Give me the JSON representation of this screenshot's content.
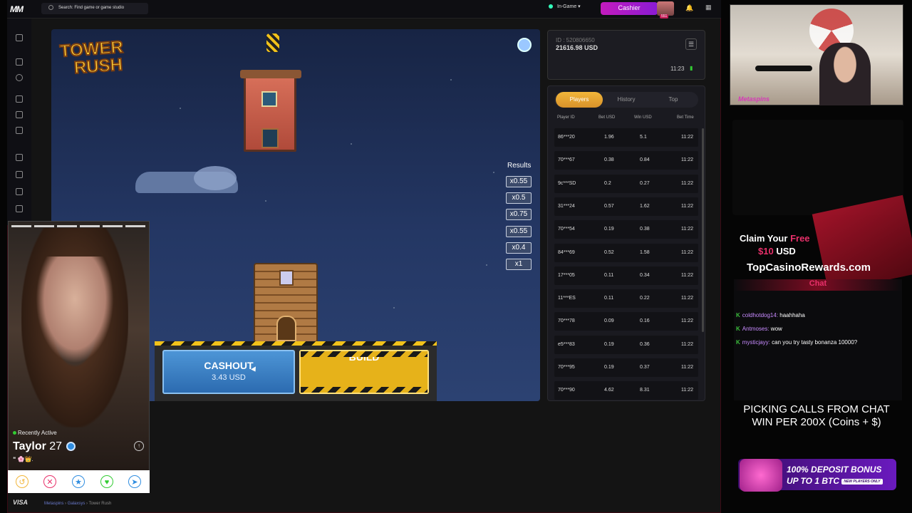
{
  "topbar": {
    "logo": "MM",
    "search_placeholder": "Search: Find game or game studio",
    "status": "In-Game",
    "cashier_label": "Cashier",
    "level_badge": "551"
  },
  "game": {
    "title_line1": "TOWER",
    "title_line2": "RUSH",
    "results_title": "Results",
    "results": [
      "x0.55",
      "x0.5",
      "x0.75",
      "x0.55",
      "x0.4",
      "x1"
    ],
    "cashout_label": "CASHOUT",
    "cashout_amount": "3.43 USD",
    "build_label": "BUILD"
  },
  "account": {
    "id": "ID : 520806650",
    "balance": "21616.98 USD",
    "time": "11:23"
  },
  "players_panel": {
    "tabs": [
      "Players",
      "History",
      "Top"
    ],
    "active_tab": "Players",
    "headers": [
      "Player ID",
      "Bet USD",
      "Win USD",
      "Bet Time"
    ],
    "rows": [
      [
        "86***20",
        "1.96",
        "5.1",
        "11:22"
      ],
      [
        "70***67",
        "0.38",
        "0.84",
        "11:22"
      ],
      [
        "9c***SD",
        "0.2",
        "0.27",
        "11:22"
      ],
      [
        "31***24",
        "0.57",
        "1.62",
        "11:22"
      ],
      [
        "70***54",
        "0.19",
        "0.38",
        "11:22"
      ],
      [
        "84***69",
        "0.52",
        "1.58",
        "11:22"
      ],
      [
        "17***05",
        "0.11",
        "0.34",
        "11:22"
      ],
      [
        "11***ES",
        "0.11",
        "0.22",
        "11:22"
      ],
      [
        "70***78",
        "0.09",
        "0.16",
        "11:22"
      ],
      [
        "e5***83",
        "0.19",
        "0.36",
        "11:22"
      ],
      [
        "70***95",
        "0.19",
        "0.37",
        "11:22"
      ],
      [
        "70***90",
        "4.62",
        "8.31",
        "11:22"
      ]
    ]
  },
  "footer": {
    "payment": "VISA",
    "breadcrumb_1": "Metaspins",
    "breadcrumb_2": "Galaxsys",
    "breadcrumb_3": "Tower Rush"
  },
  "profile_card": {
    "status": "Recently Active",
    "name": "Taylor",
    "age": "27",
    "quote": "❝ 🌸👑."
  },
  "stream": {
    "cam_brand": "Metaspins",
    "promo_claim": "Claim Your",
    "promo_free": "Free",
    "promo_amount": "$10",
    "promo_currency": "USD",
    "promo_site": "TopCasinoRewards.com",
    "chat_title": "Chat",
    "chat": [
      {
        "user": "coldhotdog14:",
        "text": " haahhaha"
      },
      {
        "user": "Antmoses:",
        "text": " wow"
      },
      {
        "user": "mysticjayy:",
        "text": " can you try tasty bonanza 10000?"
      }
    ],
    "calls_line1": "PICKING CALLS FROM CHAT",
    "calls_line2": "WIN PER 200X (Coins + $)",
    "bonus_line1": "100% DEPOSIT BONUS",
    "bonus_line2": "UP TO 1 BTC",
    "bonus_tag": "NEW PLAYERS ONLY"
  },
  "colors": {
    "accent_pink": "#e8306a",
    "cashier_purple": "#c31bbd",
    "cashout_blue": "#2c6bb0",
    "build_yellow": "#e6b21a",
    "tab_active": "#f2b63a"
  }
}
